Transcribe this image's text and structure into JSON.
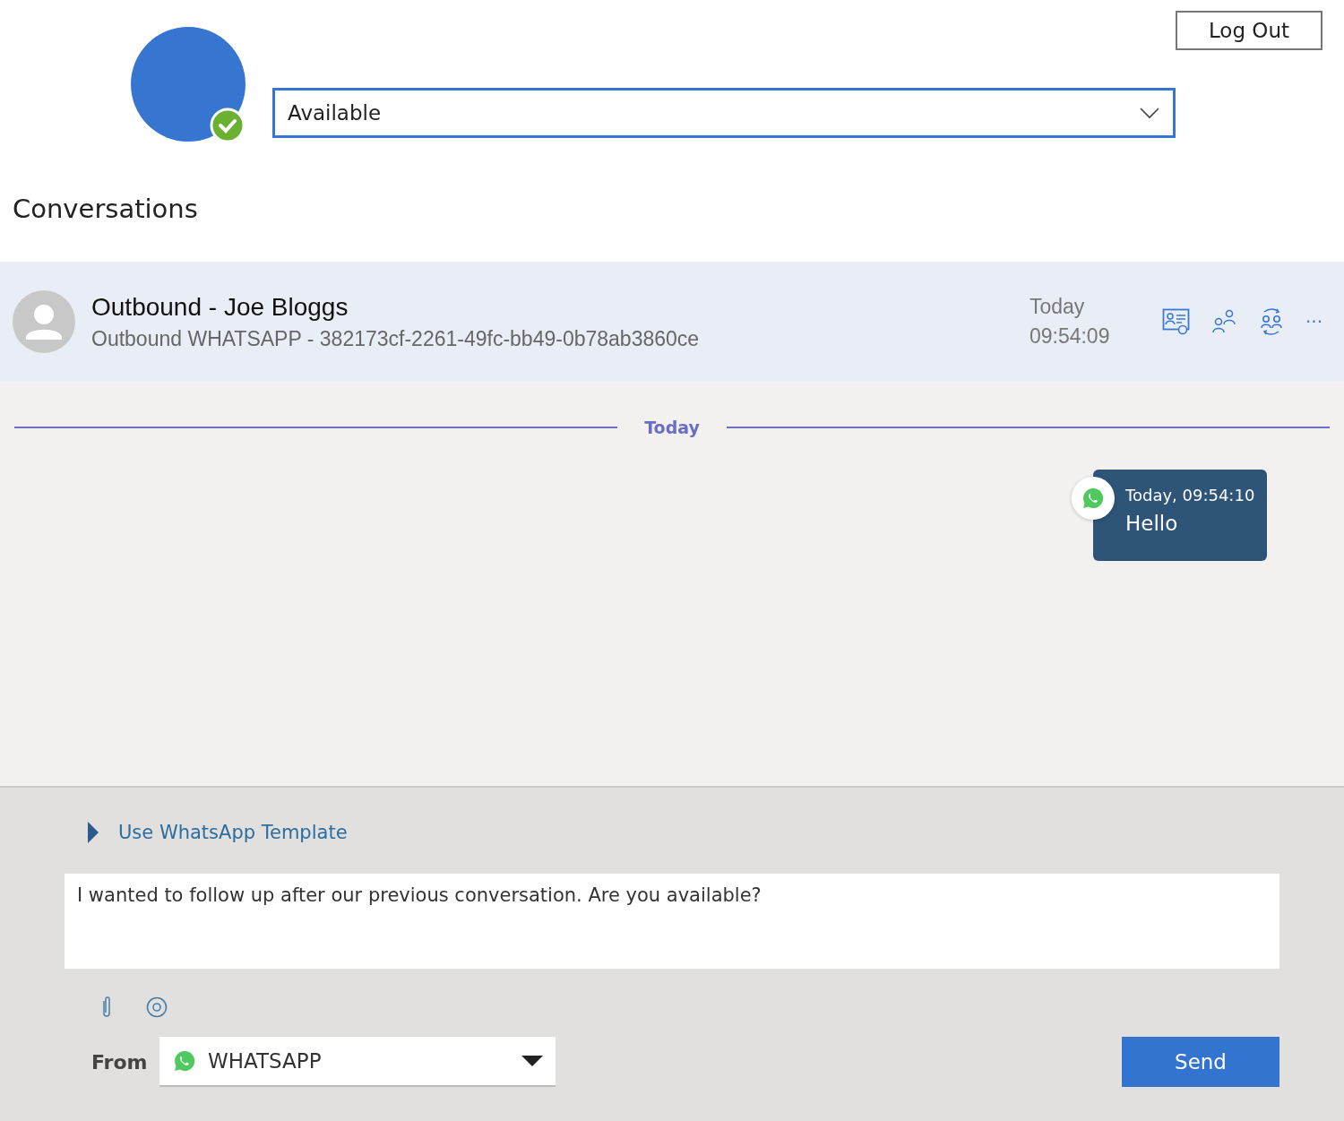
{
  "header": {
    "logout_button": "Log Out",
    "presence": {
      "value": "Available",
      "online": true
    }
  },
  "conversations_title": "Conversations",
  "conversations": [
    {
      "title": "Outbound - Joe Bloggs",
      "subtitle": "Outbound WHATSAPP - 382173cf-2261-49fc-bb49-0b78ab3860ce",
      "date": "Today",
      "time": "09:54:09",
      "selected": true,
      "more": "···"
    }
  ],
  "chat": {
    "divider": "Today",
    "messages": [
      {
        "timestamp": "Today, 09:54:10",
        "text": "Hello"
      }
    ]
  },
  "composer": {
    "template": {
      "label": "Use WhatsApp Template",
      "expanded": false
    },
    "message": {
      "value": "I wanted to follow up after our previous conversation. Are you available?"
    },
    "from_label": "From",
    "from": {
      "value": "WHATSAPP"
    },
    "send_button": "Send"
  }
}
